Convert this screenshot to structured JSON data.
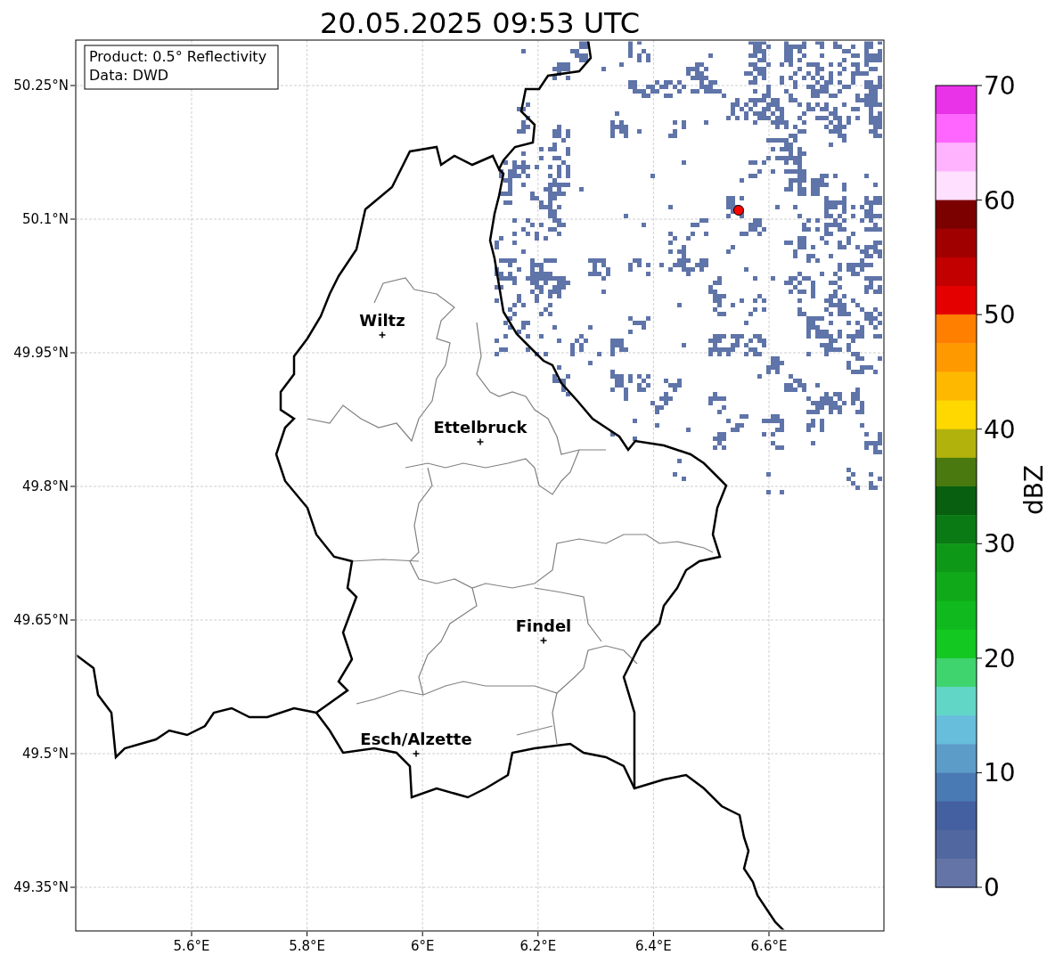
{
  "title": "20.05.2025 09:53 UTC",
  "map": {
    "info_box": [
      "Product: 0.5° Reflectivity",
      "Data: DWD"
    ],
    "y_axis_labels": [
      "50.25°N",
      "50.1°N",
      "49.95°N",
      "49.8°N",
      "49.65°N",
      "49.5°N",
      "49.35°N"
    ],
    "x_axis_labels": [
      "5.6°E",
      "5.8°E",
      "6°E",
      "6.2°E",
      "6.4°E",
      "6.6°E"
    ],
    "cities": [
      {
        "name": "Wiltz"
      },
      {
        "name": "Ettelbruck"
      },
      {
        "name": "Findel"
      },
      {
        "name": "Esch/Alzette"
      }
    ]
  },
  "colorbar": {
    "label": "dBZ",
    "ticks": [
      "70",
      "60",
      "50",
      "40",
      "30",
      "20",
      "10",
      "0"
    ],
    "bands": [
      {
        "color": "#e933e9"
      },
      {
        "color": "#ff66ff"
      },
      {
        "color": "#ffb3ff"
      },
      {
        "color": "#ffe0ff"
      },
      {
        "color": "#7b0000"
      },
      {
        "color": "#a00000"
      },
      {
        "color": "#c30000"
      },
      {
        "color": "#e50000"
      },
      {
        "color": "#ff7f00"
      },
      {
        "color": "#ff9900"
      },
      {
        "color": "#ffb800"
      },
      {
        "color": "#ffd800"
      },
      {
        "color": "#b2b20c"
      },
      {
        "color": "#4a7a0f"
      },
      {
        "color": "#075f0f"
      },
      {
        "color": "#0a7a14"
      },
      {
        "color": "#0e9818"
      },
      {
        "color": "#0fa919"
      },
      {
        "color": "#10b91d"
      },
      {
        "color": "#12c821"
      },
      {
        "color": "#3fd46e"
      },
      {
        "color": "#62d6c6"
      },
      {
        "color": "#66bddc"
      },
      {
        "color": "#5b9dc8"
      },
      {
        "color": "#4a7ab3"
      },
      {
        "color": "#4460a0"
      },
      {
        "color": "#5167a0"
      },
      {
        "color": "#6474a6"
      }
    ]
  }
}
